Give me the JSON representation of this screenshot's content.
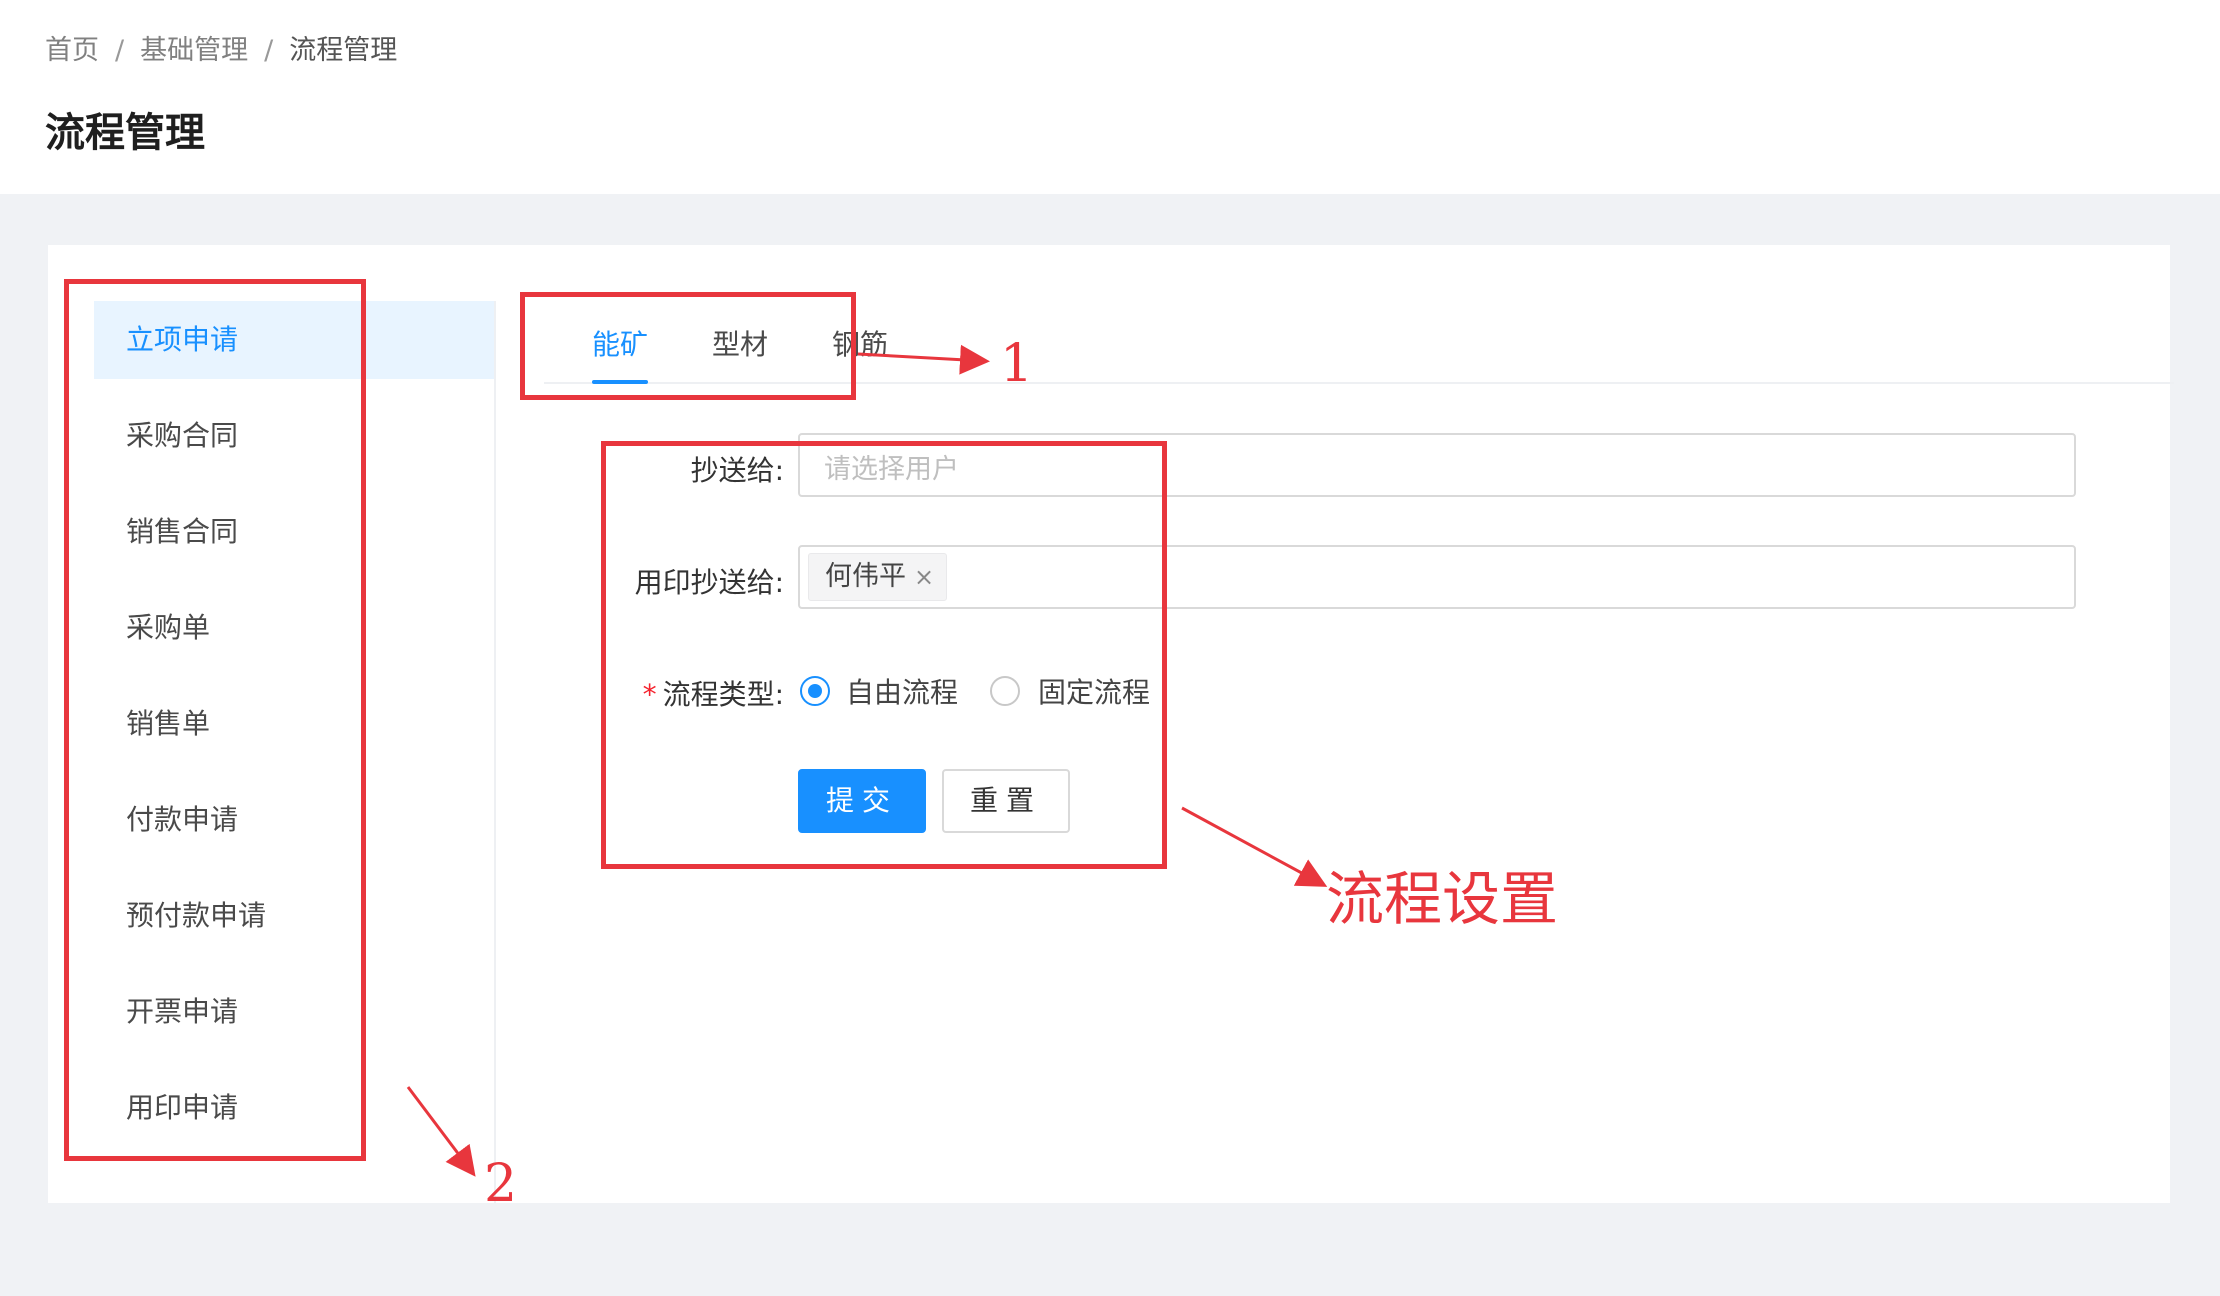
{
  "breadcrumb": {
    "home": "首页",
    "parent": "基础管理",
    "current": "流程管理",
    "separator": "/"
  },
  "page": {
    "title": "流程管理"
  },
  "menu": {
    "items": [
      {
        "label": "立项申请",
        "active": true
      },
      {
        "label": "采购合同",
        "active": false
      },
      {
        "label": "销售合同",
        "active": false
      },
      {
        "label": "采购单",
        "active": false
      },
      {
        "label": "销售单",
        "active": false
      },
      {
        "label": "付款申请",
        "active": false
      },
      {
        "label": "预付款申请",
        "active": false
      },
      {
        "label": "开票申请",
        "active": false
      },
      {
        "label": "用印申请",
        "active": false
      }
    ]
  },
  "tabs": [
    {
      "label": "能矿",
      "active": true
    },
    {
      "label": "型材",
      "active": false
    },
    {
      "label": "钢筋",
      "active": false
    }
  ],
  "form": {
    "cc": {
      "label": "抄送给:",
      "placeholder": "请选择用户"
    },
    "seal_cc": {
      "label": "用印抄送给:",
      "tags": [
        "何伟平"
      ]
    },
    "flow_type": {
      "label": "流程类型:",
      "required": true,
      "options": [
        {
          "label": "自由流程",
          "checked": true
        },
        {
          "label": "固定流程",
          "checked": false
        }
      ]
    },
    "submit_label": "提交",
    "reset_label": "重置"
  },
  "annotations": {
    "tabs": "1",
    "menu": "2",
    "form": "流程设置",
    "color": "#e8363d"
  },
  "colors": {
    "primary": "#1890ff",
    "annotation": "#e8363d",
    "background": "#f0f2f5"
  }
}
